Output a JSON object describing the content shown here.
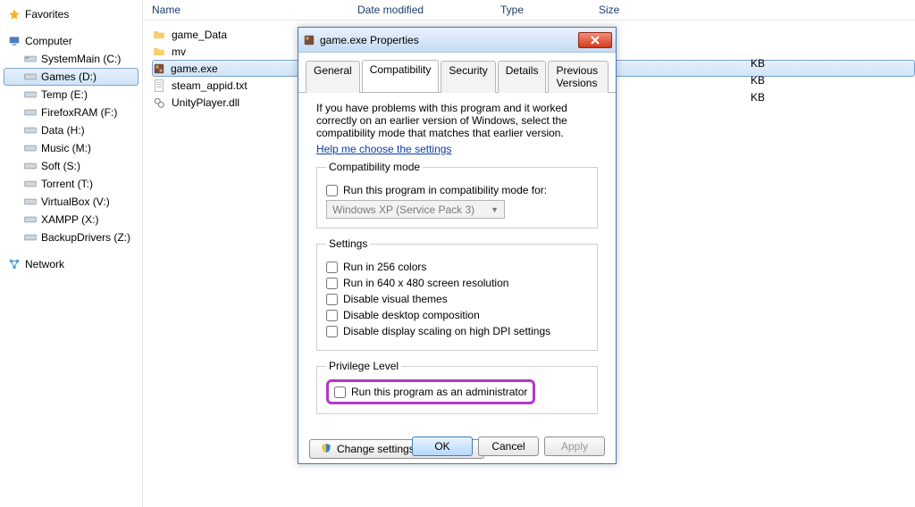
{
  "nav": {
    "favorites": "Favorites",
    "computer": "Computer",
    "drives": [
      "SystemMain (C:)",
      "Games (D:)",
      "Temp (E:)",
      "FirefoxRAM (F:)",
      "Data (H:)",
      "Music (M:)",
      "Soft (S:)",
      "Torrent (T:)",
      "VirtualBox (V:)",
      "XAMPP (X:)",
      "BackupDrivers (Z:)"
    ],
    "network": "Network"
  },
  "cols": {
    "name": "Name",
    "date": "Date modified",
    "type": "Type",
    "size": "Size"
  },
  "files": [
    {
      "name": "game_Data",
      "icon": "folder"
    },
    {
      "name": "mv",
      "icon": "folder"
    },
    {
      "name": "game.exe",
      "icon": "app",
      "selected": true,
      "size": "KB"
    },
    {
      "name": "steam_appid.txt",
      "icon": "txt",
      "size": "KB"
    },
    {
      "name": "UnityPlayer.dll",
      "icon": "dll",
      "size": "KB"
    }
  ],
  "dialog": {
    "title": "game.exe Properties",
    "tabs": [
      "General",
      "Compatibility",
      "Security",
      "Details",
      "Previous Versions"
    ],
    "active_tab": "Compatibility",
    "desc": "If you have problems with this program and it worked correctly on an earlier version of Windows, select the compatibility mode that matches that earlier version.",
    "help": "Help me choose the settings",
    "group_compat": "Compatibility mode",
    "chk_compat": "Run this program in compatibility mode for:",
    "combo_value": "Windows XP (Service Pack 3)",
    "group_settings": "Settings",
    "chk_256": "Run in 256 colors",
    "chk_640": "Run in 640 x 480 screen resolution",
    "chk_themes": "Disable visual themes",
    "chk_desktop": "Disable desktop composition",
    "chk_dpi": "Disable display scaling on high DPI settings",
    "group_priv": "Privilege Level",
    "chk_admin": "Run this program as an administrator",
    "btn_all": "Change settings for all users",
    "btn_ok": "OK",
    "btn_cancel": "Cancel",
    "btn_apply": "Apply"
  }
}
